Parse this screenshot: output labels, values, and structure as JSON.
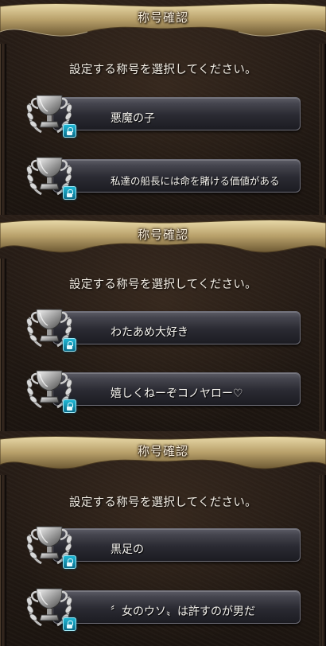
{
  "panels": [
    {
      "title": "称号確認",
      "prompt": "設定する称号を選択してください。",
      "options": [
        {
          "label": "悪魔の子",
          "icon": "silver-trophy-icon",
          "locked": true
        },
        {
          "label": "私達の船長には命を賭ける価値がある",
          "icon": "silver-trophy-icon",
          "locked": true
        }
      ]
    },
    {
      "title": "称号確認",
      "prompt": "設定する称号を選択してください。",
      "options": [
        {
          "label": "わたあめ大好き",
          "icon": "silver-trophy-icon",
          "locked": true
        },
        {
          "label": "嬉しくねーぞコノヤロー♡",
          "icon": "silver-trophy-icon",
          "locked": true
        }
      ]
    },
    {
      "title": "称号確認",
      "prompt": "設定する称号を選択してください。",
      "options": [
        {
          "label": "黒足の",
          "icon": "silver-trophy-icon",
          "locked": true
        },
        {
          "label": "〞女のウソ〟は許すのが男だ",
          "icon": "silver-trophy-icon",
          "locked": true
        }
      ]
    }
  ],
  "colors": {
    "banner_gold": "#c9b27a",
    "lock_cyan": "#1fb8d6",
    "button_dark": "#2a2a32"
  }
}
